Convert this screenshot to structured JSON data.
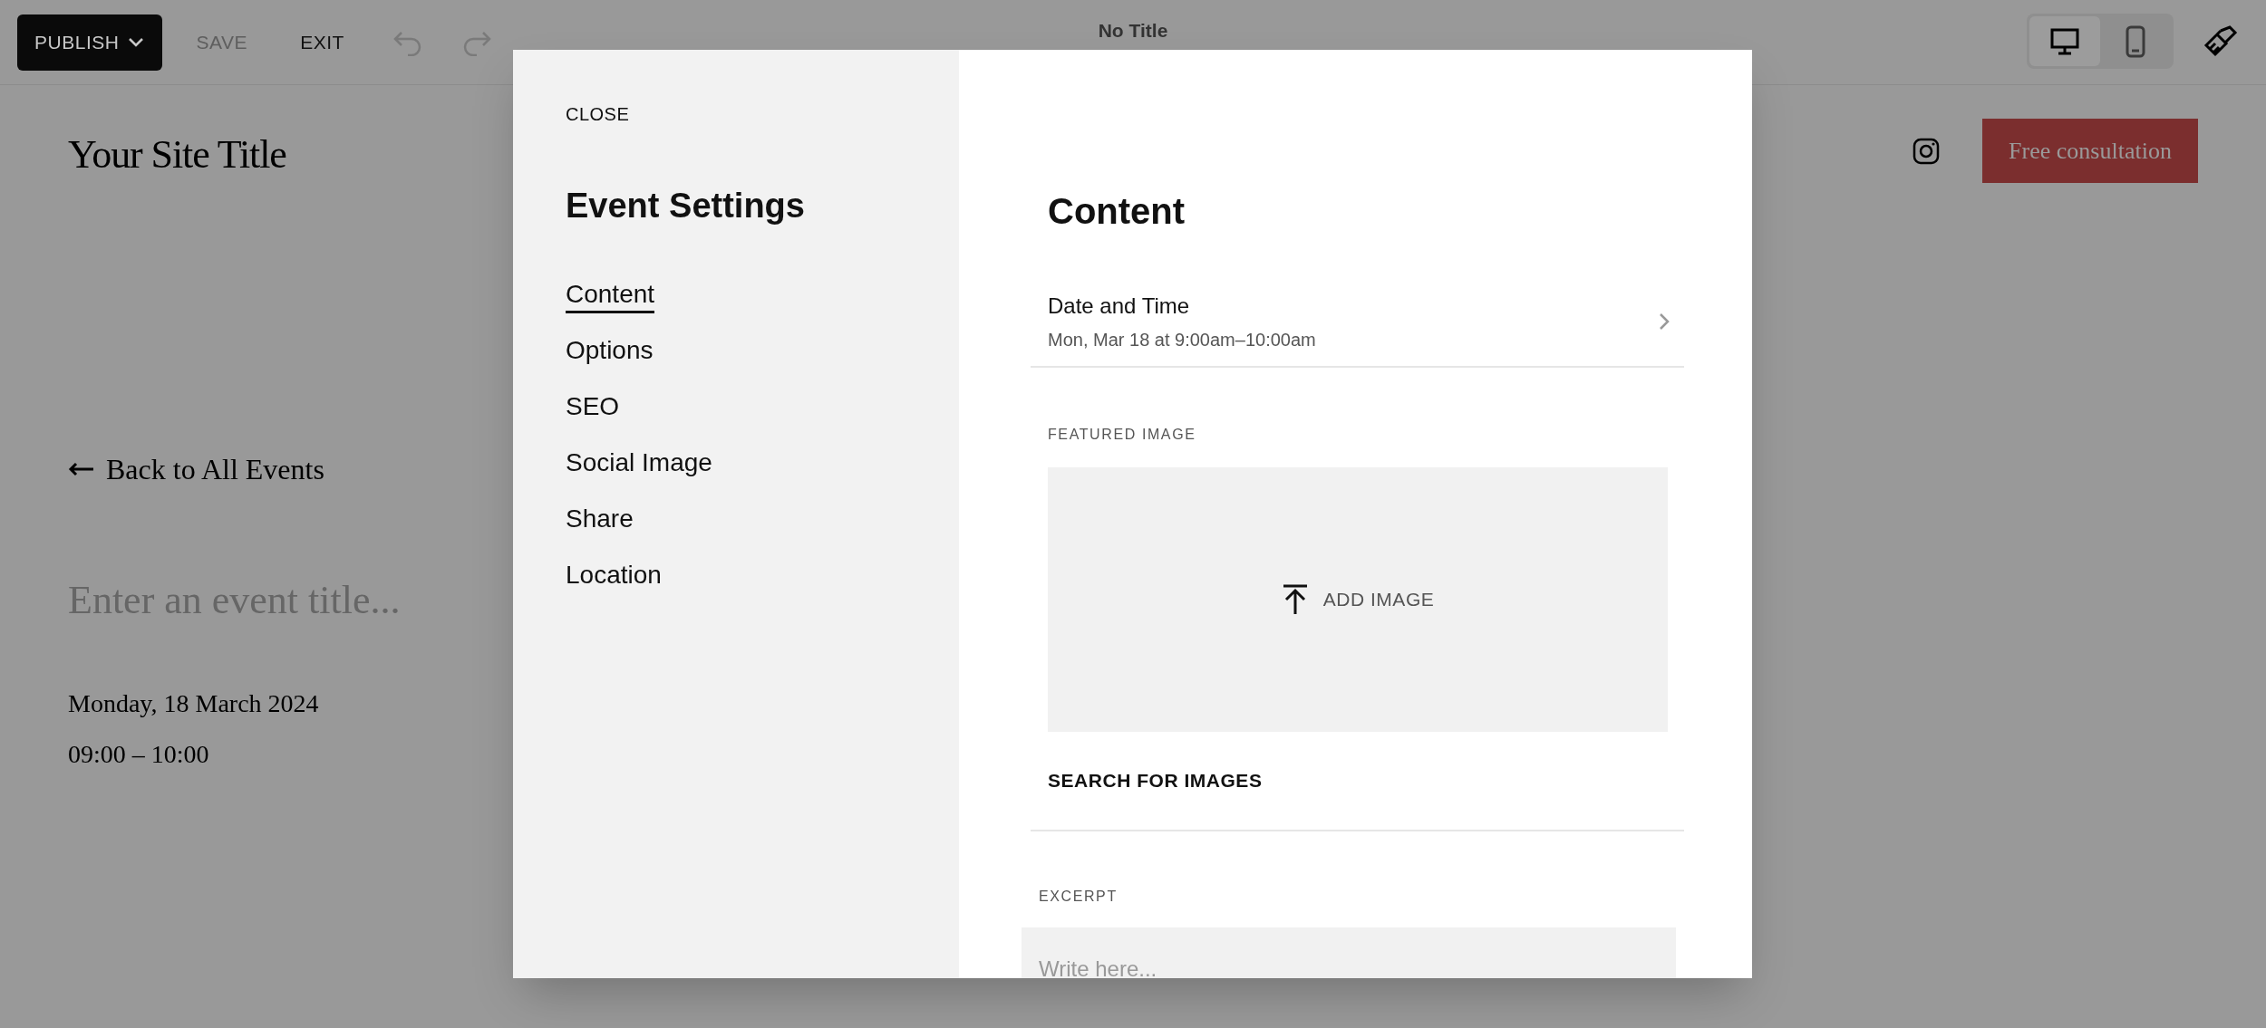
{
  "toolbar": {
    "publish": "PUBLISH",
    "save": {
      "label": "SAVE",
      "disabled": true
    },
    "exit": "EXIT",
    "title": "No Title",
    "devices": [
      {
        "kind": "desktop",
        "selected": true
      },
      {
        "kind": "mobile",
        "selected": false
      }
    ]
  },
  "site": {
    "title": "Your Site Title",
    "cta": "Free consultation",
    "back_link": "Back to All Events",
    "event_title_placeholder": "Enter an event title...",
    "date": "Monday, 18 March 2024",
    "time": "09:00 – 10:00"
  },
  "modal": {
    "close": "CLOSE",
    "title": "Event Settings",
    "nav": [
      {
        "label": "Content",
        "selected": true
      },
      {
        "label": "Options",
        "selected": false
      },
      {
        "label": "SEO",
        "selected": false
      },
      {
        "label": "Social Image",
        "selected": false
      },
      {
        "label": "Share",
        "selected": false
      },
      {
        "label": "Location",
        "selected": false
      }
    ],
    "heading": "Content",
    "date_time": {
      "label": "Date and Time",
      "value": "Mon, Mar 18 at 9:00am–10:00am"
    },
    "featured_image": {
      "label": "FEATURED IMAGE",
      "add": "ADD IMAGE",
      "search": "SEARCH FOR IMAGES"
    },
    "excerpt": {
      "label": "EXCERPT",
      "placeholder": "Write here..."
    }
  }
}
